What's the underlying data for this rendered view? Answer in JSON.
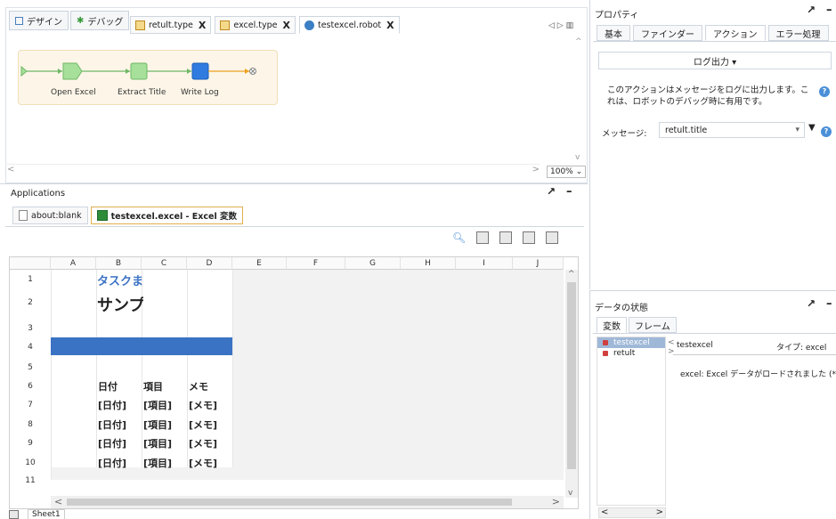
{
  "editor": {
    "view_tabs": [
      {
        "label": "デザイン"
      },
      {
        "label": "デバッグ"
      }
    ],
    "file_tabs": [
      {
        "label": "retult.type",
        "close": "X"
      },
      {
        "label": "excel.type",
        "close": "X"
      },
      {
        "label": "testexcel.robot",
        "close": "X"
      }
    ],
    "nav": "◁ ▷ ▥",
    "flow_steps": [
      {
        "label": "Open Excel"
      },
      {
        "label": "Extract Title"
      },
      {
        "label": "Write Log"
      }
    ],
    "zoom": "100%"
  },
  "applications": {
    "title": "Applications",
    "tabs": [
      {
        "label": "about:blank"
      },
      {
        "label": "testexcel.excel - Excel 変数"
      }
    ]
  },
  "sheet": {
    "columns": [
      "A",
      "B",
      "C",
      "D",
      "E",
      "F",
      "G",
      "H",
      "I",
      "J"
    ],
    "rows": [
      "1",
      "2",
      "3",
      "4",
      "5",
      "6",
      "7",
      "8",
      "9",
      "10",
      "11"
    ],
    "b1": "タスクま",
    "b2": "サンプ",
    "row6": [
      "日付",
      "項目",
      "メモ"
    ],
    "row7": [
      "[日付]",
      "[項目]",
      "[メモ]"
    ],
    "row8": [
      "[日付]",
      "[項目]",
      "[メモ]"
    ],
    "row9": [
      "[日付]",
      "[項目]",
      "[メモ]"
    ],
    "row10": [
      "[日付]",
      "[項目]",
      "[メモ]"
    ],
    "sheet_tab": "Sheet1"
  },
  "properties": {
    "title": "プロパティ",
    "tabs": [
      {
        "label": "基本"
      },
      {
        "label": "ファインダー"
      },
      {
        "label": "アクション"
      },
      {
        "label": "エラー処理"
      }
    ],
    "action_select": "ログ出力 ▾",
    "description": "このアクションはメッセージをログに出力します。これは、ロボットのデバッグ時に有用です。",
    "message_label": "メッセージ:",
    "message_value": "retult.title",
    "help": "?"
  },
  "data_state": {
    "title": "データの状態",
    "tabs": [
      {
        "label": "変数"
      },
      {
        "label": "フレーム"
      }
    ],
    "variables": [
      "testexcel",
      "retult"
    ],
    "detail_name": "testexcel",
    "detail_type": "タイプ: excel",
    "detail_msg": "excel: Excel データがロードされました (*.x"
  },
  "colors": {
    "accent_blue": "#2f7be0",
    "selected_row": "#3b73c4",
    "flow_bg": "#fdf6e8"
  }
}
